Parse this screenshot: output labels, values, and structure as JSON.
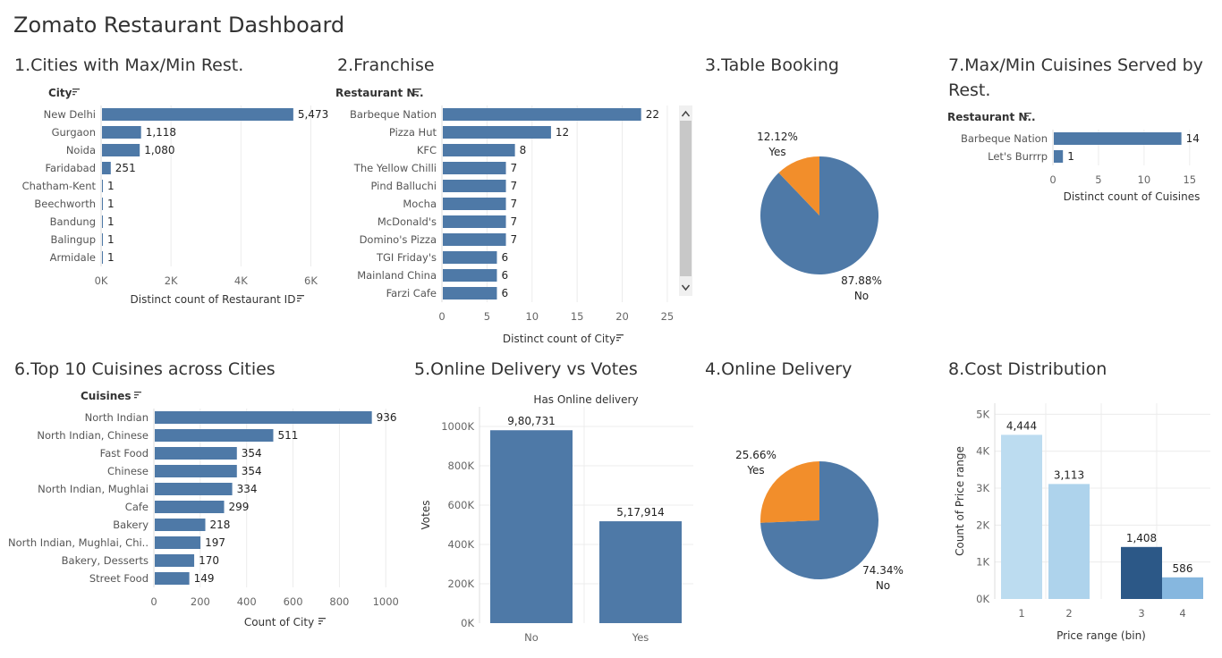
{
  "dashboard_title": "Zomato Restaurant Dashboard",
  "colors": {
    "blue": "#4e79a7",
    "orange": "#f28e2b",
    "light1": "#bcdcf0",
    "light2": "#aed3ec",
    "dark": "#2c5887",
    "light4": "#86b7df",
    "grid": "#ececec",
    "scroll": "#c8c8c8"
  },
  "sort_icon": "sort-icon",
  "chart_data": [
    {
      "id": "c1",
      "type": "bar",
      "orientation": "horizontal",
      "title": "1.Cities with Max/Min Rest.",
      "row_header": "City",
      "categories": [
        "New Delhi",
        "Gurgaon",
        "Noida",
        "Faridabad",
        "Chatham-Kent",
        "Beechworth",
        "Bandung",
        "Balingup",
        "Armidale"
      ],
      "values": [
        5473,
        1118,
        1080,
        251,
        1,
        1,
        1,
        1,
        1
      ],
      "value_labels": [
        "5,473",
        "1,118",
        "1,080",
        "251",
        "1",
        "1",
        "1",
        "1",
        "1"
      ],
      "xlim": [
        0,
        6500
      ],
      "ticks": [
        0,
        2000,
        4000,
        6000
      ],
      "tick_labels": [
        "0K",
        "2K",
        "4K",
        "6K"
      ],
      "xlabel": "Distinct count of Restaurant ID",
      "grid": true
    },
    {
      "id": "c2",
      "type": "bar",
      "orientation": "horizontal",
      "title": "2.Franchise",
      "row_header": "Restaurant N..",
      "categories": [
        "Barbeque Nation",
        "Pizza Hut",
        "KFC",
        "The Yellow Chilli",
        "Pind Balluchi",
        "Mocha",
        "McDonald's",
        "Domino's Pizza",
        "TGI Friday's",
        "Mainland China",
        "Farzi Cafe"
      ],
      "values": [
        22,
        12,
        8,
        7,
        7,
        7,
        7,
        7,
        6,
        6,
        6
      ],
      "value_labels": [
        "22",
        "12",
        "8",
        "7",
        "7",
        "7",
        "7",
        "7",
        "6",
        "6",
        "6"
      ],
      "xlim": [
        0,
        26
      ],
      "ticks": [
        0,
        5,
        10,
        15,
        20,
        25
      ],
      "tick_labels": [
        "0",
        "5",
        "10",
        "15",
        "20",
        "25"
      ],
      "xlabel": "Distinct count of City",
      "grid": true,
      "scrollbar": true
    },
    {
      "id": "c3",
      "type": "pie",
      "title": "3.Table Booking",
      "slices": [
        {
          "name": "No",
          "value": 87.88,
          "label": "87.88%"
        },
        {
          "name": "Yes",
          "value": 12.12,
          "label": "12.12%"
        }
      ]
    },
    {
      "id": "c7",
      "type": "bar",
      "orientation": "horizontal",
      "title": "7.Max/Min Cuisines Served by Rest.",
      "row_header": "Restaurant N..",
      "categories": [
        "Barbeque Nation",
        "Let's Burrrp"
      ],
      "values": [
        14,
        1
      ],
      "value_labels": [
        "14",
        "1"
      ],
      "xlim": [
        0,
        16
      ],
      "ticks": [
        0,
        5,
        10,
        15
      ],
      "tick_labels": [
        "0",
        "5",
        "10",
        "15"
      ],
      "xlabel": "Distinct count of Cuisines",
      "grid": true
    },
    {
      "id": "c6",
      "type": "bar",
      "orientation": "horizontal",
      "title": "6.Top 10 Cuisines across Cities",
      "row_header": "Cuisines",
      "categories": [
        "North Indian",
        "North Indian, Chinese",
        "Fast Food",
        "Chinese",
        "North Indian, Mughlai",
        "Cafe",
        "Bakery",
        "North Indian, Mughlai, Chi..",
        "Bakery, Desserts",
        "Street Food"
      ],
      "values": [
        936,
        511,
        354,
        354,
        334,
        299,
        218,
        197,
        170,
        149
      ],
      "value_labels": [
        "936",
        "511",
        "354",
        "354",
        "334",
        "299",
        "218",
        "197",
        "170",
        "149"
      ],
      "xlim": [
        0,
        1080
      ],
      "ticks": [
        0,
        200,
        400,
        600,
        800,
        1000
      ],
      "tick_labels": [
        "0",
        "200",
        "400",
        "600",
        "800",
        "1000"
      ],
      "xlabel": "Count of City",
      "grid": true
    },
    {
      "id": "c5",
      "type": "bar",
      "orientation": "vertical",
      "title": "5.Online Delivery vs Votes",
      "column_header": "Has Online delivery",
      "categories": [
        "No",
        "Yes"
      ],
      "values": [
        980731,
        517914
      ],
      "value_labels": [
        "9,80,731",
        "5,17,914"
      ],
      "ylim": [
        0,
        1100000
      ],
      "ticks": [
        0,
        200000,
        400000,
        600000,
        800000,
        1000000
      ],
      "tick_labels": [
        "0K",
        "200K",
        "400K",
        "600K",
        "800K",
        "1000K"
      ],
      "ylabel": "Votes",
      "grid": true
    },
    {
      "id": "c4",
      "type": "pie",
      "title": "4.Online Delivery",
      "slices": [
        {
          "name": "No",
          "value": 74.34,
          "label": "74.34%"
        },
        {
          "name": "Yes",
          "value": 25.66,
          "label": "25.66%"
        }
      ]
    },
    {
      "id": "c8",
      "type": "bar",
      "orientation": "vertical",
      "title": "8.Cost Distribution",
      "categories": [
        "1",
        "2",
        "3",
        "4"
      ],
      "values": [
        4444,
        3113,
        1408,
        586
      ],
      "value_labels": [
        "4,444",
        "3,113",
        "1,408",
        "586"
      ],
      "ylim": [
        0,
        5300
      ],
      "ticks": [
        0,
        1000,
        2000,
        3000,
        4000,
        5000
      ],
      "tick_labels": [
        "0K",
        "1K",
        "2K",
        "3K",
        "4K",
        "5K"
      ],
      "xlabel": "Price range (bin)",
      "ylabel": "Count of Price range",
      "grid": true
    }
  ]
}
